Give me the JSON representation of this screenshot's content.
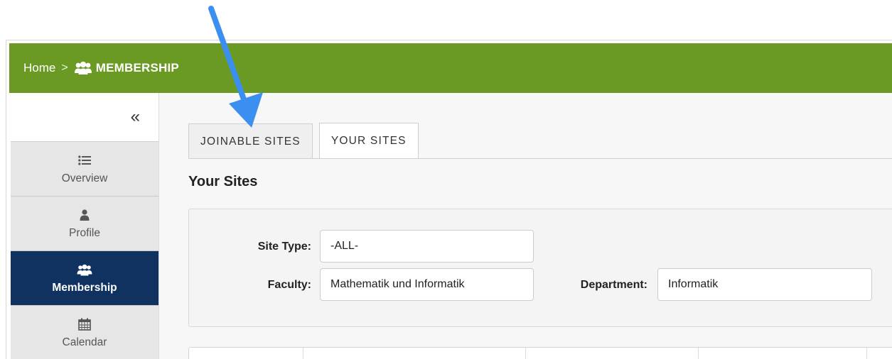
{
  "header": {
    "breadcrumb_home": "Home",
    "breadcrumb_separator": ">",
    "breadcrumb_current": "MEMBERSHIP",
    "breadcrumb_icon": "users-icon",
    "bar_color": "#6a9a23"
  },
  "sidebar": {
    "collapse_symbol": "«",
    "items": [
      {
        "label": "Overview",
        "icon": "list-icon",
        "active": false
      },
      {
        "label": "Profile",
        "icon": "user-icon",
        "active": false
      },
      {
        "label": "Membership",
        "icon": "users-icon",
        "active": true
      },
      {
        "label": "Calendar",
        "icon": "calendar-icon",
        "active": false
      }
    ],
    "active_color": "#0f3260"
  },
  "tabs": [
    {
      "label": "JOINABLE SITES",
      "active": false
    },
    {
      "label": "YOUR SITES",
      "active": true
    }
  ],
  "page_title": "Your Sites",
  "filters": {
    "site_type_label": "Site Type:",
    "site_type_value": "-ALL-",
    "faculty_label": "Faculty:",
    "faculty_value": "Mathematik und Informatik",
    "department_label": "Department:",
    "department_value": "Informatik"
  },
  "annotation": {
    "type": "arrow",
    "color": "#3b8ff0",
    "points_to": "tab-joinable-sites"
  }
}
